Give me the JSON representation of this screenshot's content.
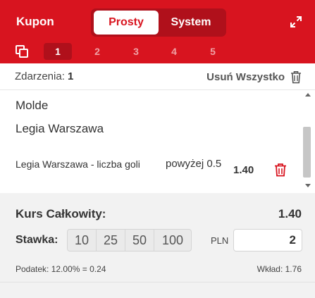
{
  "header": {
    "title": "Kupon",
    "tabs": [
      "Prosty",
      "System"
    ],
    "active_tab": "Prosty",
    "slots": [
      "1",
      "2",
      "3",
      "4",
      "5"
    ],
    "active_slot": "1",
    "colors": {
      "brand": "#d8141f",
      "brand_dark": "#b0101b"
    }
  },
  "events_bar": {
    "label": "Zdarzenia:",
    "count": "1",
    "remove_all": "Usuń Wszystko"
  },
  "selection": {
    "home_team": "Molde",
    "away_team": "Legia Warszawa",
    "market": "Legia Warszawa - liczba goli",
    "pick": "powyżej 0.5",
    "odds": "1.40"
  },
  "summary": {
    "total_label": "Kurs Całkowity:",
    "total_odds": "1.40",
    "stake_label": "Stawka:",
    "quick_stakes": [
      "10",
      "25",
      "50",
      "100"
    ],
    "currency": "PLN",
    "stake_value": "2",
    "tax": "Podatek: 12.00% = 0.24",
    "deposit": "Wkład: 1.76"
  }
}
